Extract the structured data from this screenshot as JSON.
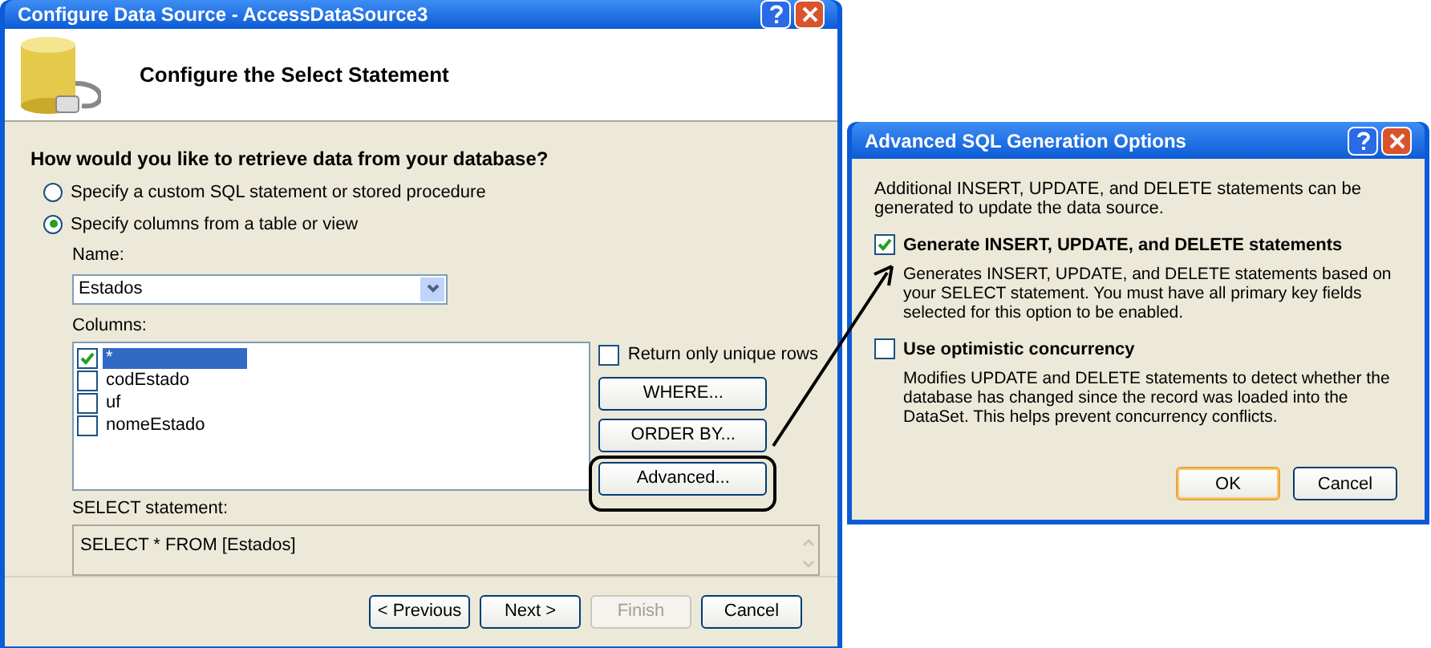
{
  "wizard": {
    "title": "Configure Data Source - AccessDataSource3",
    "header": "Configure the Select Statement",
    "question": "How would you like to retrieve data from your database?",
    "options": [
      {
        "label": "Specify a custom SQL statement or stored procedure",
        "selected": false
      },
      {
        "label": "Specify columns from a table or view",
        "selected": true
      }
    ],
    "name_label": "Name:",
    "name_value": "Estados",
    "columns_label": "Columns:",
    "columns": [
      {
        "label": "*",
        "checked": true,
        "selected": true
      },
      {
        "label": "codEstado",
        "checked": false,
        "selected": false
      },
      {
        "label": "uf",
        "checked": false,
        "selected": false
      },
      {
        "label": "nomeEstado",
        "checked": false,
        "selected": false
      }
    ],
    "unique_rows": {
      "label": "Return only unique rows",
      "checked": false
    },
    "side_buttons": [
      {
        "label": "WHERE...",
        "circled": false
      },
      {
        "label": "ORDER BY...",
        "circled": false
      },
      {
        "label": "Advanced...",
        "circled": true
      }
    ],
    "select_label": "SELECT statement:",
    "select_value": "SELECT * FROM [Estados]",
    "nav_buttons": [
      {
        "label": "< Previous",
        "disabled": false
      },
      {
        "label": "Next >",
        "disabled": false
      },
      {
        "label": "Finish",
        "disabled": true
      },
      {
        "label": "Cancel",
        "disabled": false
      }
    ]
  },
  "advanced": {
    "title": "Advanced SQL Generation Options",
    "intro": "Additional INSERT, UPDATE, and DELETE statements can be generated to update the data source.",
    "options": [
      {
        "label": "Generate INSERT, UPDATE, and DELETE statements",
        "checked": true,
        "description": "Generates INSERT, UPDATE, and DELETE statements based on your SELECT statement. You must have all primary key fields selected for this option to be enabled."
      },
      {
        "label": "Use optimistic concurrency",
        "checked": false,
        "description": "Modifies UPDATE and DELETE statements to detect whether the database has changed since the record was loaded into the DataSet. This helps prevent concurrency conflicts."
      }
    ],
    "buttons": [
      {
        "label": "OK",
        "default": true
      },
      {
        "label": "Cancel",
        "default": false
      }
    ]
  }
}
